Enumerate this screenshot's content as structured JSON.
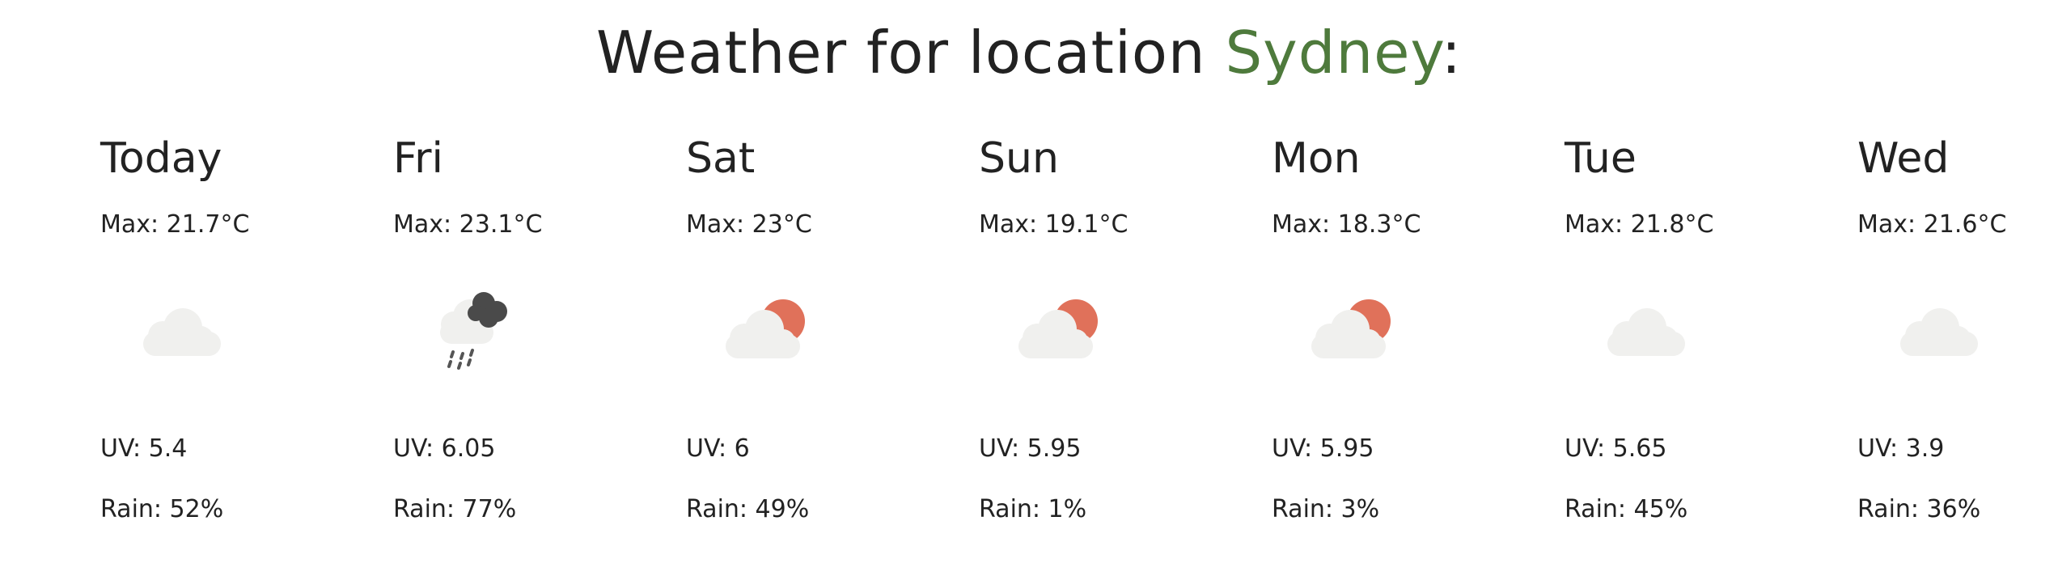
{
  "header": {
    "prefix": "Weather for location ",
    "city": "Sydney",
    "suffix": ":"
  },
  "colors": {
    "accent_city": "#4e7a3c",
    "cloud_light": "#f0f0ee",
    "cloud_dark": "#4a4a4a",
    "sun": "#e0715a",
    "text": "#222222"
  },
  "days": [
    {
      "name": "Today",
      "max": "Max: 21.7°C",
      "icon": "cloud-icon",
      "uv": "UV: 5.4",
      "rain": "Rain: 52%"
    },
    {
      "name": "Fri",
      "max": "Max: 23.1°C",
      "icon": "rain-cloud-icon",
      "uv": "UV: 6.05",
      "rain": "Rain: 77%"
    },
    {
      "name": "Sat",
      "max": "Max: 23°C",
      "icon": "partly-sunny-icon",
      "uv": "UV: 6",
      "rain": "Rain: 49%"
    },
    {
      "name": "Sun",
      "max": "Max: 19.1°C",
      "icon": "partly-sunny-icon",
      "uv": "UV: 5.95",
      "rain": "Rain: 1%"
    },
    {
      "name": "Mon",
      "max": "Max: 18.3°C",
      "icon": "partly-sunny-icon",
      "uv": "UV: 5.95",
      "rain": "Rain: 3%"
    },
    {
      "name": "Tue",
      "max": "Max: 21.8°C",
      "icon": "cloud-icon",
      "uv": "UV: 5.65",
      "rain": "Rain: 45%"
    },
    {
      "name": "Wed",
      "max": "Max: 21.6°C",
      "icon": "cloud-icon",
      "uv": "UV: 3.9",
      "rain": "Rain: 36%"
    }
  ]
}
